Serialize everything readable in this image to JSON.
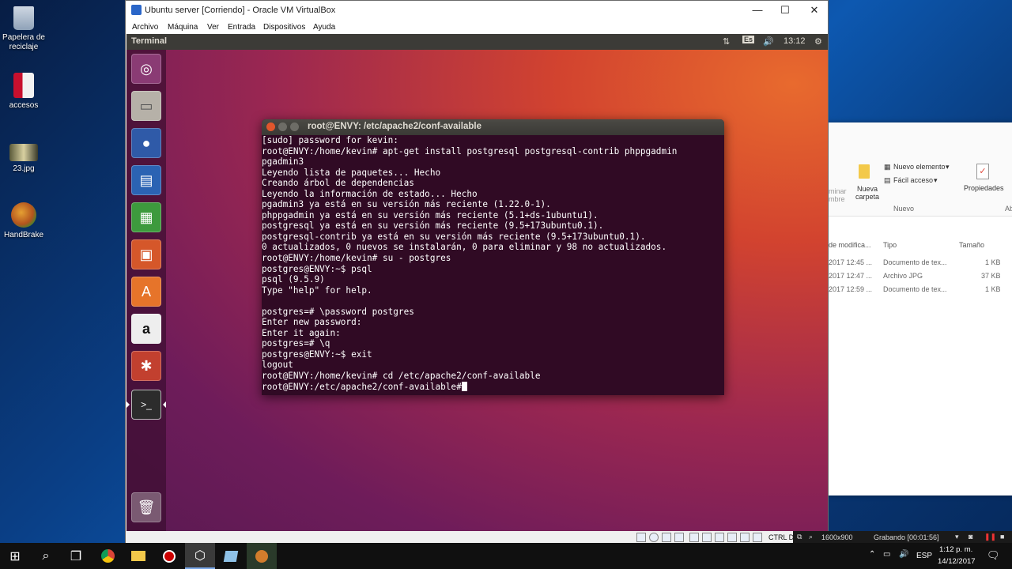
{
  "desktop_icons": [
    {
      "label": "Papelera de\nreciclaje",
      "icon": "recycle-bin-icon"
    },
    {
      "label": "accesos",
      "icon": "folder-shortcut-icon"
    },
    {
      "label": "23.jpg",
      "icon": "image-file-icon"
    },
    {
      "label": "HandBrake",
      "icon": "handbrake-icon"
    }
  ],
  "explorer": {
    "ribbon": {
      "new_item": "Nuevo elemento",
      "easy_access": "Fácil acceso",
      "new_folder": "Nueva\ncarpeta",
      "group_new": "Nuevo",
      "properties": "Propiedades",
      "open_partial": "Abri",
      "delete_partial": "minar",
      "rename_partial": "mbre"
    },
    "columns": {
      "modified": "de modifica...",
      "type": "Tipo",
      "size": "Tamaño"
    },
    "rows": [
      {
        "date": "2017 12:45 ...",
        "type": "Documento de tex...",
        "size": "1 KB"
      },
      {
        "date": "2017 12:47 ...",
        "type": "Archivo JPG",
        "size": "37 KB"
      },
      {
        "date": "2017 12:59 ...",
        "type": "Documento de tex...",
        "size": "1 KB"
      }
    ]
  },
  "vbox": {
    "title": "Ubuntu server [Corriendo] - Oracle VM VirtualBox",
    "menu": [
      "Archivo",
      "Máquina",
      "Ver",
      "Entrada",
      "Dispositivos",
      "Ayuda"
    ],
    "status": {
      "host_key": "CTRL DI"
    }
  },
  "ubuntu": {
    "panel_title": "Terminal",
    "keyboard": "Es",
    "clock": "13:12",
    "launcher": [
      "ubuntu-dash-icon",
      "files-icon",
      "firefox-icon",
      "writer-icon",
      "calc-icon",
      "impress-icon",
      "software-center-icon",
      "amazon-icon",
      "system-settings-icon",
      "terminal-icon",
      "trash-icon"
    ]
  },
  "terminal": {
    "title": "root@ENVY: /etc/apache2/conf-available",
    "lines": [
      "[sudo] password for kevin:",
      "root@ENVY:/home/kevin# apt-get install postgresql postgresql-contrib phppgadmin",
      "pgadmin3",
      "Leyendo lista de paquetes... Hecho",
      "Creando árbol de dependencias",
      "Leyendo la información de estado... Hecho",
      "pgadmin3 ya está en su versión más reciente (1.22.0-1).",
      "phppgadmin ya está en su versión más reciente (5.1+ds-1ubuntu1).",
      "postgresql ya está en su versión más reciente (9.5+173ubuntu0.1).",
      "postgresql-contrib ya está en su versión más reciente (9.5+173ubuntu0.1).",
      "0 actualizados, 0 nuevos se instalarán, 0 para eliminar y 98 no actualizados.",
      "root@ENVY:/home/kevin# su - postgres",
      "postgres@ENVY:~$ psql",
      "psql (9.5.9)",
      "Type \"help\" for help.",
      "",
      "postgres=# \\password postgres",
      "Enter new password:",
      "Enter it again:",
      "postgres=# \\q",
      "postgres@ENVY:~$ exit",
      "logout",
      "root@ENVY:/home/kevin# cd /etc/apache2/conf-available",
      "root@ENVY:/etc/apache2/conf-available#"
    ]
  },
  "recorder": {
    "resolution": "1600x900",
    "status": "Grabando [00:01:56]"
  },
  "taskbar": {
    "lang": "ESP",
    "time": "1:12 p. m.",
    "date": "14/12/2017",
    "apps": [
      "start-icon",
      "search-icon",
      "task-view-icon",
      "chrome-icon",
      "file-explorer-icon",
      "recorder-icon",
      "virtualbox-icon",
      "vbox-guest-icon",
      "handbrake-task-icon"
    ]
  }
}
